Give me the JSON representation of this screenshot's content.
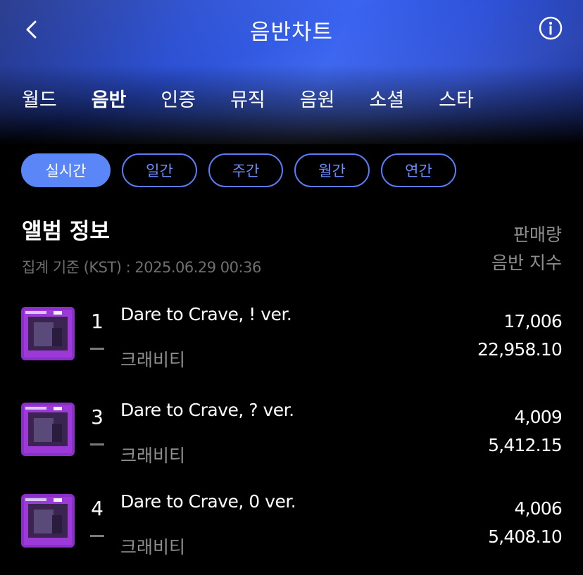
{
  "header": {
    "title": "음반차트"
  },
  "category_tabs": [
    {
      "label": "월드",
      "active": false
    },
    {
      "label": "음반",
      "active": true
    },
    {
      "label": "인증",
      "active": false
    },
    {
      "label": "뮤직",
      "active": false
    },
    {
      "label": "음원",
      "active": false
    },
    {
      "label": "소셜",
      "active": false
    },
    {
      "label": "스타",
      "active": false
    }
  ],
  "period_tabs": [
    {
      "label": "실시간",
      "active": true
    },
    {
      "label": "일간",
      "active": false
    },
    {
      "label": "주간",
      "active": false
    },
    {
      "label": "월간",
      "active": false
    },
    {
      "label": "연간",
      "active": false
    }
  ],
  "section": {
    "title": "앨범 정보",
    "basis": "집계 기준 (KST) : 2025.06.29 00:36",
    "col_sales": "판매량",
    "col_index": "음반 지수"
  },
  "rows": [
    {
      "rank": "1",
      "title": "Dare to Crave, ! ver.",
      "artist": "크래비티",
      "sales": "17,006",
      "index": "22,958.10"
    },
    {
      "rank": "3",
      "title": "Dare to Crave, ? ver.",
      "artist": "크래비티",
      "sales": "4,009",
      "index": "5,412.15"
    },
    {
      "rank": "4",
      "title": "Dare to Crave, 0 ver.",
      "artist": "크래비티",
      "sales": "4,006",
      "index": "5,408.10"
    }
  ],
  "colors": {
    "accent": "#5b86f7",
    "header_gradient": "#2b4fd2",
    "cover_purple": "#8a2fc9"
  }
}
